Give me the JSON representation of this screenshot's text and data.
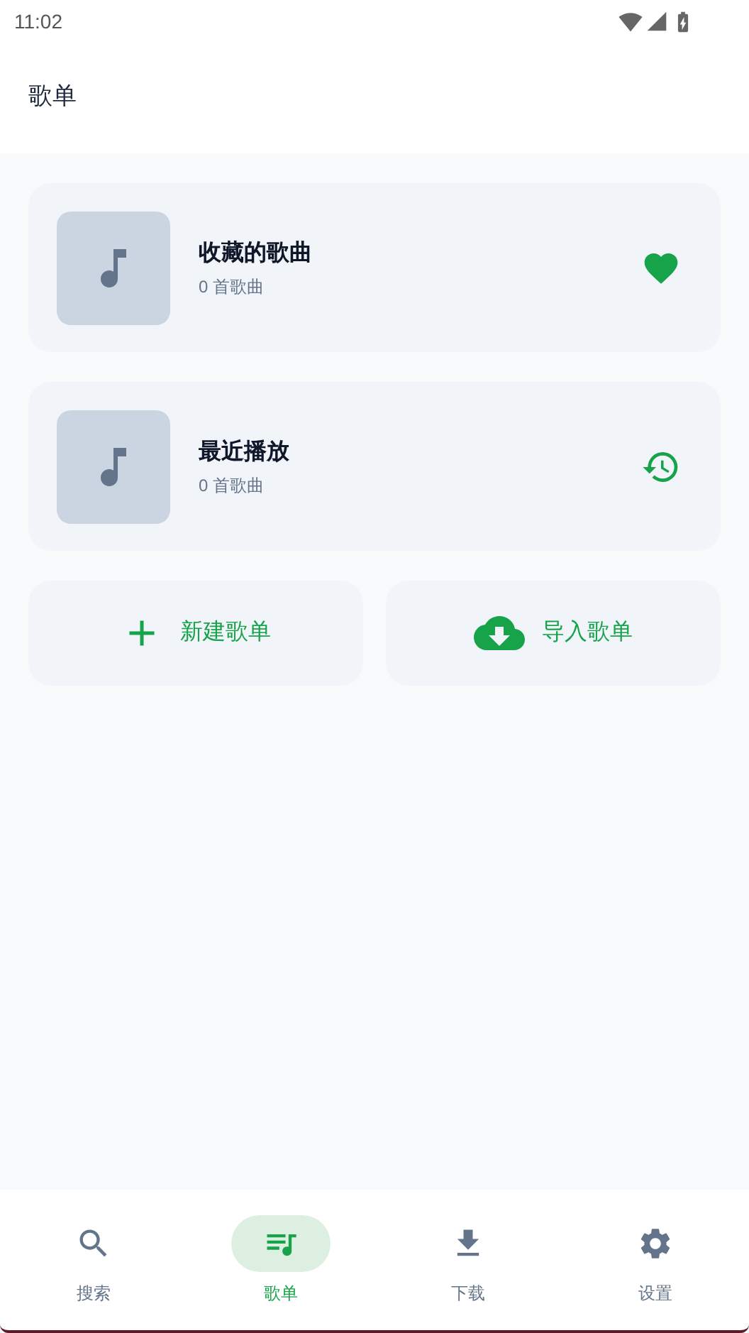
{
  "status_bar": {
    "time": "11:02"
  },
  "header": {
    "title": "歌单"
  },
  "playlists": [
    {
      "kind": "favorites",
      "title": "收藏的歌曲",
      "count": "0 首歌曲"
    },
    {
      "kind": "recent",
      "title": "最近播放",
      "count": "0 首歌曲"
    }
  ],
  "actions": [
    {
      "kind": "create",
      "label": "新建歌单"
    },
    {
      "kind": "import",
      "label": "导入歌单"
    }
  ],
  "bottom_nav": [
    {
      "kind": "search",
      "label": "搜索",
      "selected": false
    },
    {
      "kind": "playlists",
      "label": "歌单",
      "selected": true
    },
    {
      "kind": "download",
      "label": "下载",
      "selected": false
    },
    {
      "kind": "settings",
      "label": "设置",
      "selected": false
    }
  ]
}
